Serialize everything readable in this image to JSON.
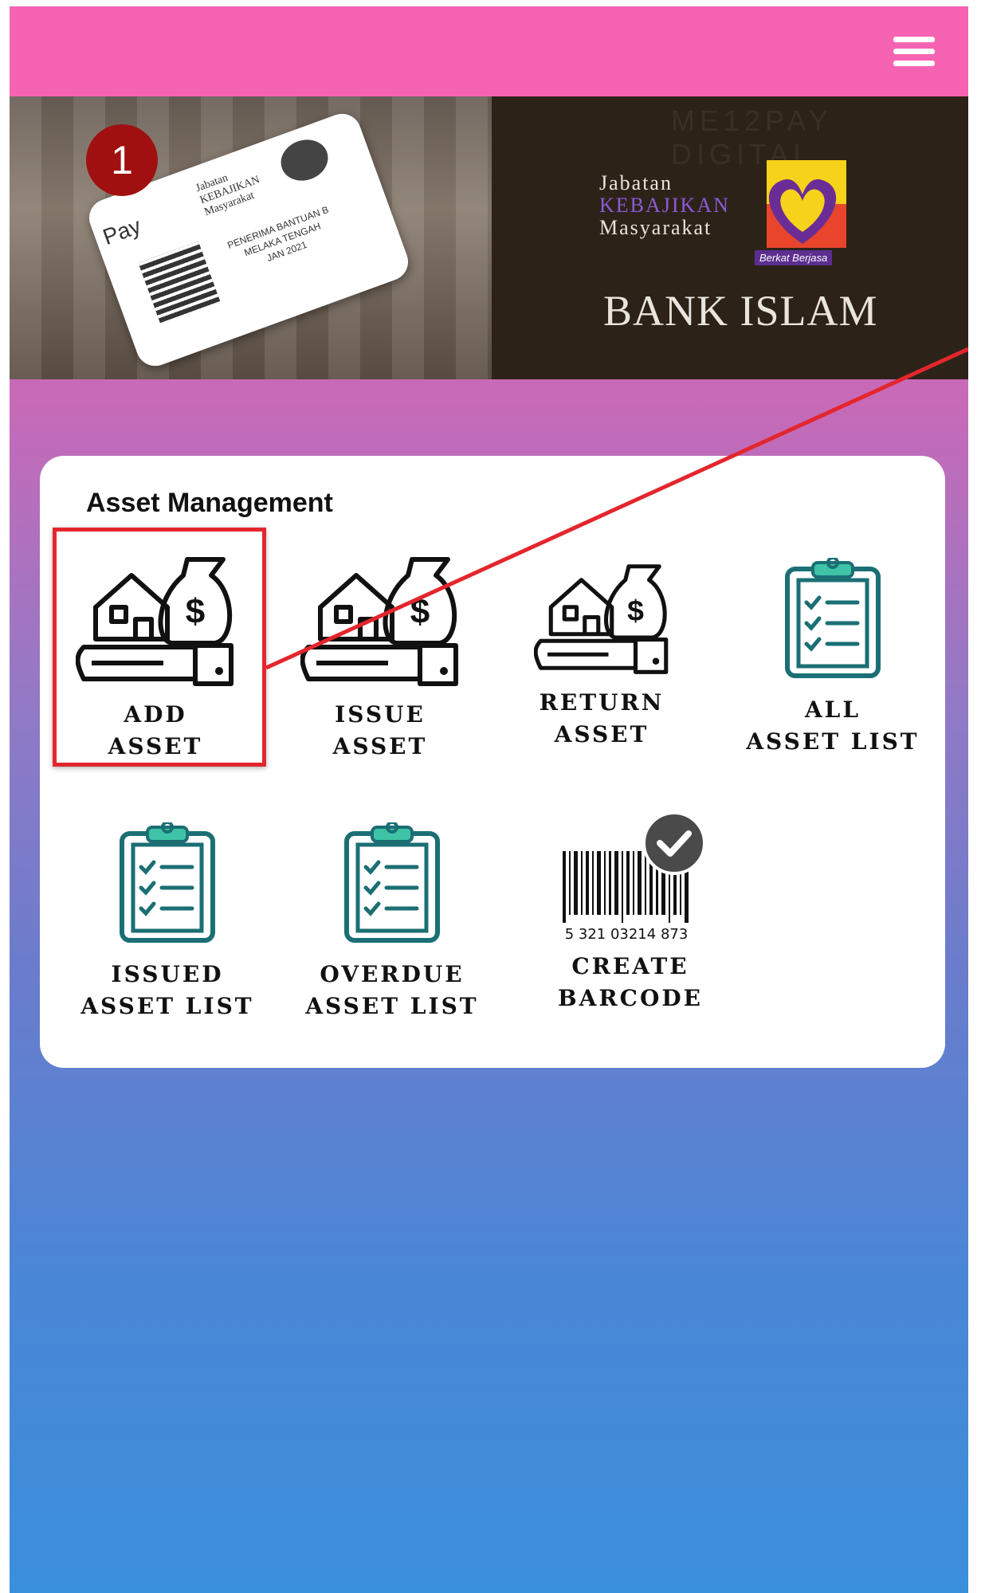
{
  "header": {
    "menu_icon": "hamburger-menu-icon"
  },
  "banner": {
    "card": {
      "brand": "Pay",
      "org_line1": "Jabatan",
      "org_line2": "KEBAJIKAN",
      "org_line3": "Masyarakat",
      "recipient_line1": "PENERIMA BANTUAN B",
      "recipient_line2": "MELAKA TENGAH",
      "recipient_line3": "JAN 2021"
    },
    "watermark": "ME12PAY DIGITAL",
    "jkm_line1": "Jabatan",
    "jkm_line2": "KEBAJIKAN",
    "jkm_line3": "Masyarakat",
    "jkm_tagline": "Berkat Berjasa",
    "bank_name": "BANK ISLAM"
  },
  "annotation": {
    "step_number": "1",
    "highlight_color": "#e3262d"
  },
  "panel": {
    "title": "Asset Management",
    "tiles": [
      {
        "label_line1": "ADD",
        "label_line2": "ASSET",
        "icon": "asset-hand-icon"
      },
      {
        "label_line1": "ISSUE",
        "label_line2": "ASSET",
        "icon": "asset-hand-icon"
      },
      {
        "label_line1": "RETURN",
        "label_line2": "ASSET",
        "icon": "asset-hand-icon"
      },
      {
        "label_line1": "ALL",
        "label_line2": "ASSET LIST",
        "icon": "clipboard-list-icon"
      },
      {
        "label_line1": "ISSUED",
        "label_line2": "ASSET LIST",
        "icon": "clipboard-list-icon"
      },
      {
        "label_line1": "OVERDUE",
        "label_line2": "ASSET LIST",
        "icon": "clipboard-list-icon"
      },
      {
        "label_line1": "CREATE",
        "label_line2": "BARCODE",
        "icon": "barcode-check-icon",
        "barcode_digits": "5 321 03214 873"
      }
    ]
  },
  "colors": {
    "topbar": "#f663b2",
    "accent_teal": "#1b6f74",
    "clipboard_clip": "#3fc3a6"
  }
}
